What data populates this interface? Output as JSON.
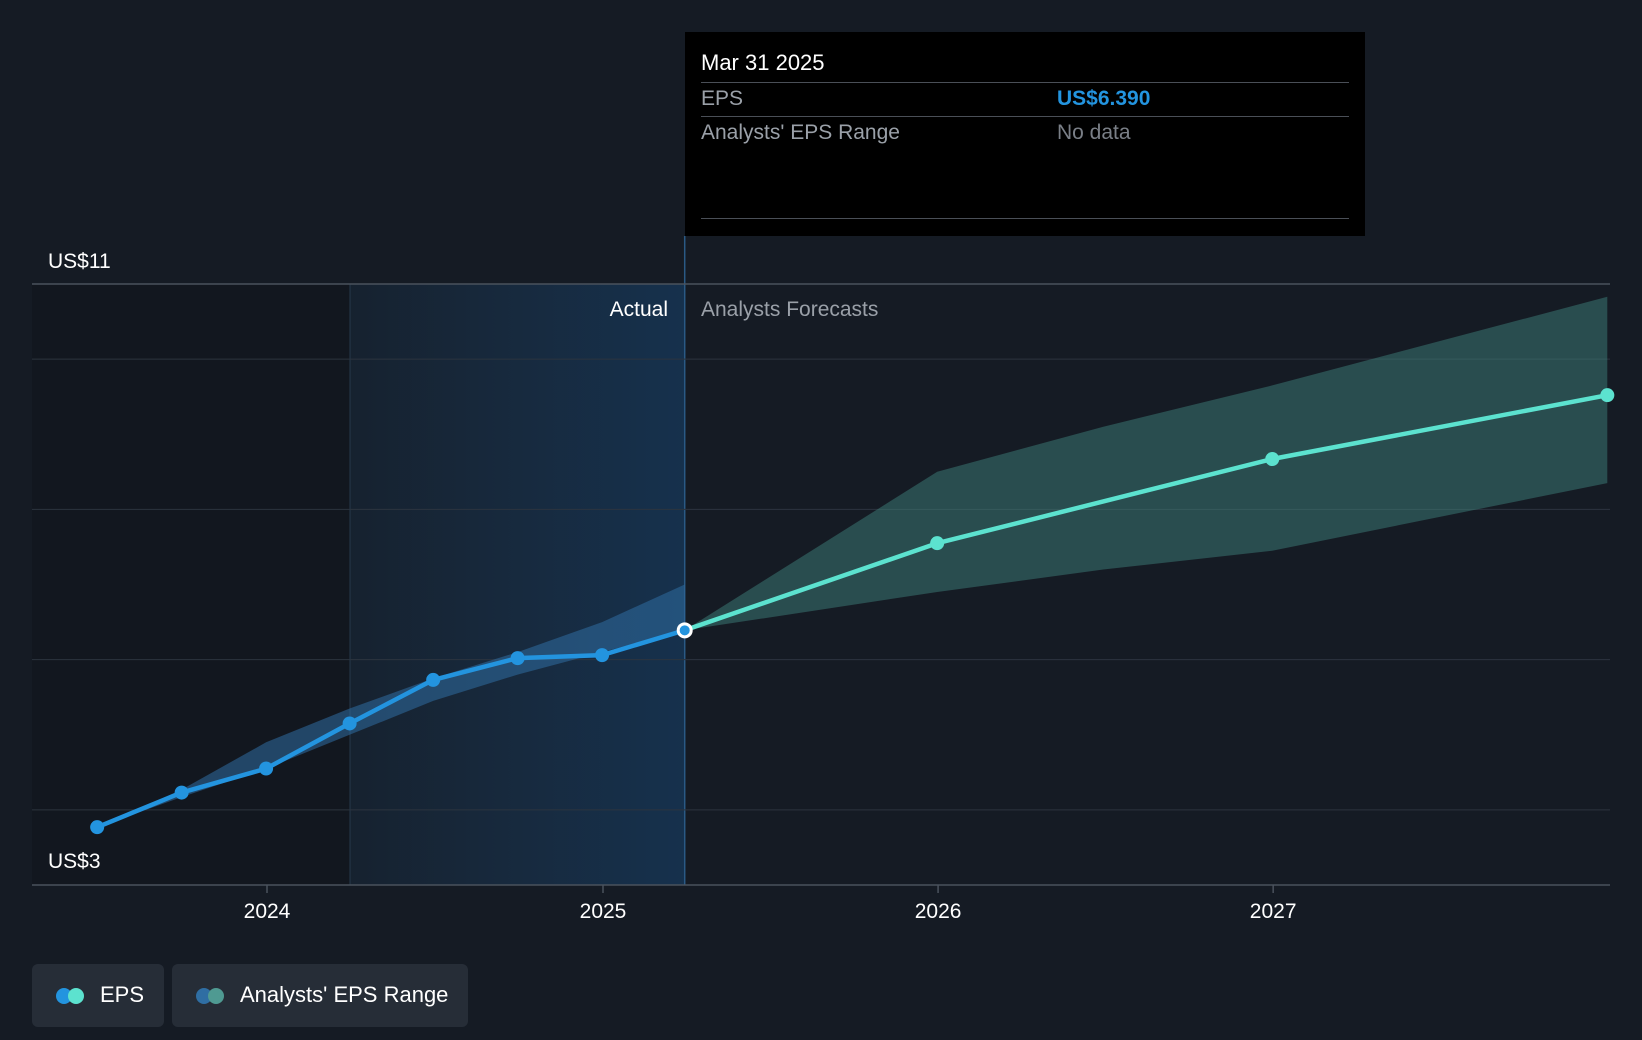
{
  "chart_data": {
    "type": "line",
    "y_axis": {
      "min": 3,
      "max": 11,
      "top_label": "US$11",
      "bottom_label": "US$3"
    },
    "x_ticks": [
      "2024",
      "2025",
      "2026",
      "2027"
    ],
    "section_labels": {
      "actual": "Actual",
      "forecast": "Analysts Forecasts"
    },
    "series": [
      {
        "name": "EPS",
        "kind": "actual",
        "color": "#2394df",
        "points": [
          {
            "x": "2023-06-30",
            "y": 3.77
          },
          {
            "x": "2023-09-30",
            "y": 4.23
          },
          {
            "x": "2023-12-31",
            "y": 4.55
          },
          {
            "x": "2024-03-31",
            "y": 5.15
          },
          {
            "x": "2024-06-30",
            "y": 5.73
          },
          {
            "x": "2024-09-30",
            "y": 6.02
          },
          {
            "x": "2024-12-31",
            "y": 6.06
          },
          {
            "x": "2025-03-31",
            "y": 6.39
          }
        ]
      },
      {
        "name": "EPS",
        "kind": "forecast",
        "color": "#5ce2cf",
        "points": [
          {
            "x": "2025-03-31",
            "y": 6.39
          },
          {
            "x": "2025-12-31",
            "y": 7.55
          },
          {
            "x": "2026-12-31",
            "y": 8.67
          },
          {
            "x": "2027-12-31",
            "y": 9.52
          }
        ]
      }
    ],
    "ranges": [
      {
        "name": "Analysts' EPS Range",
        "kind": "actual",
        "color": "#2f6ea3",
        "points": [
          {
            "x": "2023-06-30",
            "low": 3.77,
            "high": 3.77
          },
          {
            "x": "2023-09-30",
            "low": 4.17,
            "high": 4.27
          },
          {
            "x": "2023-12-31",
            "low": 4.55,
            "high": 4.9
          },
          {
            "x": "2024-03-31",
            "low": 5.0,
            "high": 5.35
          },
          {
            "x": "2024-06-30",
            "low": 5.45,
            "high": 5.75
          },
          {
            "x": "2024-09-30",
            "low": 5.8,
            "high": 6.1
          },
          {
            "x": "2024-12-31",
            "low": 6.1,
            "high": 6.5
          },
          {
            "x": "2025-03-31",
            "low": 6.39,
            "high": 7.0
          }
        ]
      },
      {
        "name": "Analysts' EPS Range",
        "kind": "forecast",
        "color": "#3d7f7a",
        "points": [
          {
            "x": "2025-03-31",
            "low": 6.39,
            "high": 6.39
          },
          {
            "x": "2025-12-31",
            "low": 6.9,
            "high": 8.5
          },
          {
            "x": "2026-06-30",
            "low": 7.2,
            "high": 9.1
          },
          {
            "x": "2026-12-31",
            "low": 7.45,
            "high": 9.65
          },
          {
            "x": "2027-12-31",
            "low": 8.35,
            "high": 10.83
          }
        ]
      }
    ],
    "grid": true
  },
  "tooltip": {
    "date": "Mar 31 2025",
    "eps_label": "EPS",
    "eps_value": "US$6.390",
    "range_label": "Analysts' EPS Range",
    "range_value": "No data"
  },
  "legend": {
    "eps_label": "EPS",
    "range_label": "Analysts' EPS Range",
    "eps_dot_colors": [
      "#2394df",
      "#5ce2cf"
    ],
    "range_dot_colors": [
      "#2f6ea3",
      "#4f9a92"
    ]
  }
}
